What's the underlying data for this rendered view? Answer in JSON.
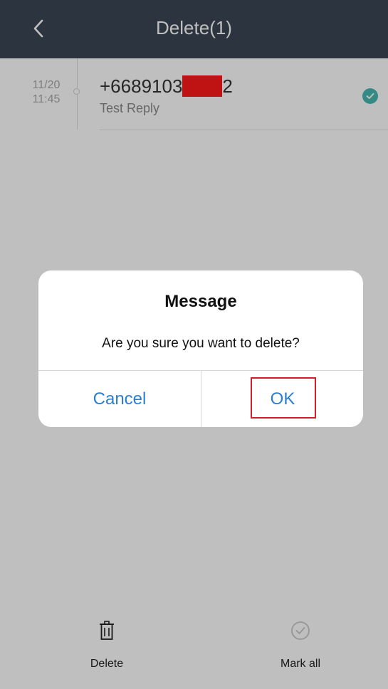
{
  "header": {
    "title": "Delete(1)",
    "back_icon": "chevron-left-icon"
  },
  "message_list": [
    {
      "date": "11/20",
      "time": "11:45",
      "sender_prefix": "+6689103",
      "sender_suffix": "2",
      "preview": "Test Reply",
      "selected": true
    }
  ],
  "bottom_bar": {
    "delete_label": "Delete",
    "mark_all_label": "Mark all"
  },
  "dialog": {
    "title": "Message",
    "body": "Are you sure you want to delete?",
    "cancel_label": "Cancel",
    "ok_label": "OK"
  },
  "colors": {
    "topbar_bg": "#3b4754",
    "accent_link": "#2b7fd1",
    "check_teal": "#46b8b0",
    "highlight_red": "#d21e2b",
    "redaction_red": "#ff1a1a"
  }
}
